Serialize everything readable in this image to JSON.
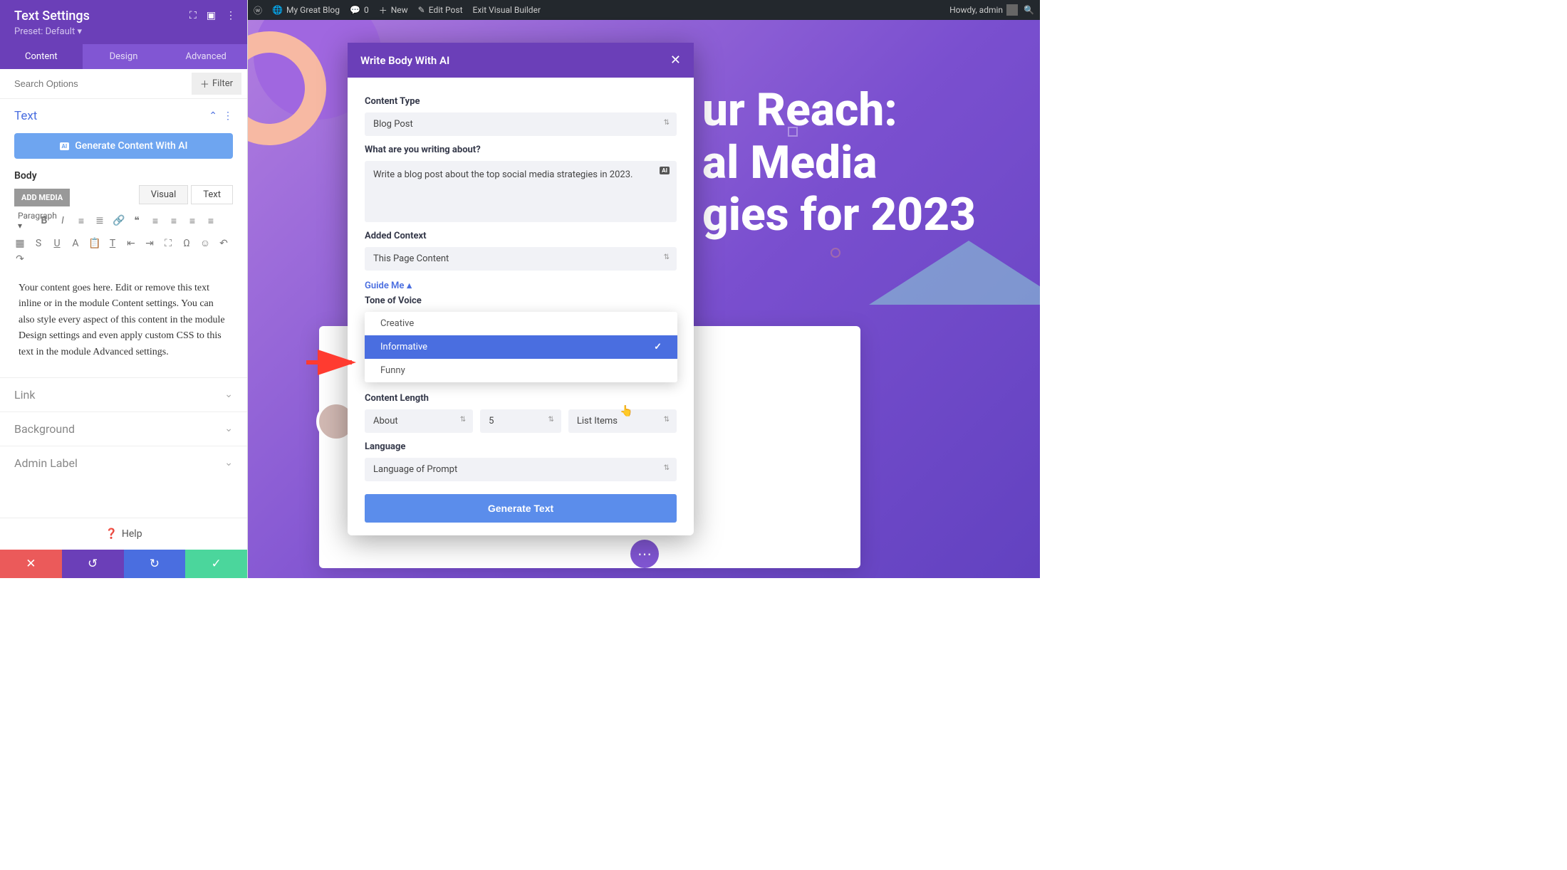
{
  "wp_bar": {
    "site_name": "My Great Blog",
    "comments": "0",
    "new": "New",
    "edit": "Edit Post",
    "exit": "Exit Visual Builder",
    "howdy": "Howdy, admin"
  },
  "sidebar": {
    "title": "Text Settings",
    "preset": "Preset: Default",
    "tabs": {
      "content": "Content",
      "design": "Design",
      "advanced": "Advanced"
    },
    "search_placeholder": "Search Options",
    "filter": "Filter",
    "section_text": "Text",
    "gen_ai": "Generate Content With AI",
    "body_label": "Body",
    "add_media": "ADD MEDIA",
    "editor_tabs": {
      "visual": "Visual",
      "text": "Text"
    },
    "format_select": "Paragraph",
    "sample_content": "Your content goes here. Edit or remove this text inline or in the module Content settings. You can also style every aspect of this content in the module Design settings and even apply custom CSS to this text in the module Advanced settings.",
    "sections": {
      "link": "Link",
      "background": "Background",
      "admin": "Admin Label"
    },
    "help": "Help"
  },
  "preview": {
    "headline_l1": "ur Reach:",
    "headline_l2": "al Media",
    "headline_l3": "gies for 2023"
  },
  "modal": {
    "title": "Write Body With AI",
    "content_type_label": "Content Type",
    "content_type_value": "Blog Post",
    "about_label": "What are you writing about?",
    "about_value": "Write a blog post about the top social media strategies in 2023.",
    "ai_badge": "AI",
    "context_label": "Added Context",
    "context_value": "This Page Content",
    "guide_me": "Guide Me",
    "tone_label": "Tone of Voice",
    "tone_options": [
      "Creative",
      "Informative",
      "Funny"
    ],
    "tone_selected": "Informative",
    "length_label": "Content Length",
    "length_about": "About",
    "length_num": "5",
    "length_unit": "List Items",
    "language_label": "Language",
    "language_value": "Language of Prompt",
    "generate": "Generate Text"
  }
}
